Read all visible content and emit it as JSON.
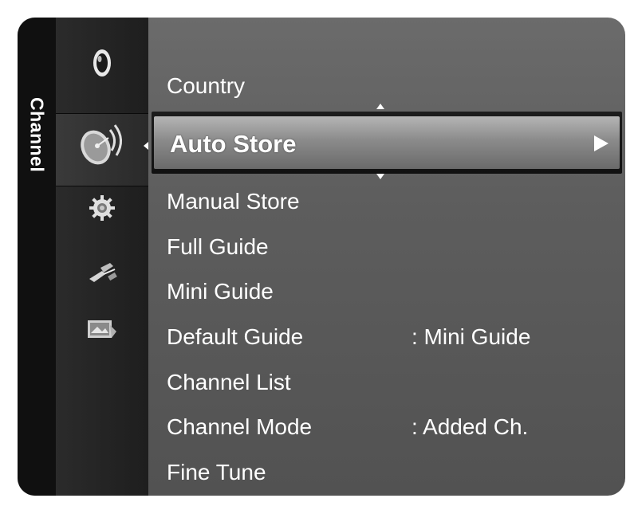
{
  "sidebar": {
    "tab_label": "Channel",
    "icons": [
      {
        "name": "picture-icon",
        "selected": false
      },
      {
        "name": "channel-antenna-icon",
        "selected": true
      },
      {
        "name": "setup-gear-icon",
        "selected": false
      },
      {
        "name": "input-plug-icon",
        "selected": false
      },
      {
        "name": "application-icon",
        "selected": false
      }
    ]
  },
  "menu": {
    "items": [
      {
        "label": "Country",
        "value": ""
      },
      {
        "label": "Auto Store",
        "value": "",
        "selected": true
      },
      {
        "label": "Manual Store",
        "value": ""
      },
      {
        "label": "Full Guide",
        "value": ""
      },
      {
        "label": "Mini Guide",
        "value": ""
      },
      {
        "label": "Default Guide",
        "value": ": Mini Guide"
      },
      {
        "label": "Channel List",
        "value": ""
      },
      {
        "label": "Channel Mode",
        "value": ": Added Ch."
      },
      {
        "label": "Fine Tune",
        "value": ""
      }
    ]
  },
  "colors": {
    "panel": "#5d5d5d",
    "sidebar": "#101010",
    "icon_column": "#222222",
    "highlight": "#9a9a9a",
    "text": "#ffffff"
  }
}
